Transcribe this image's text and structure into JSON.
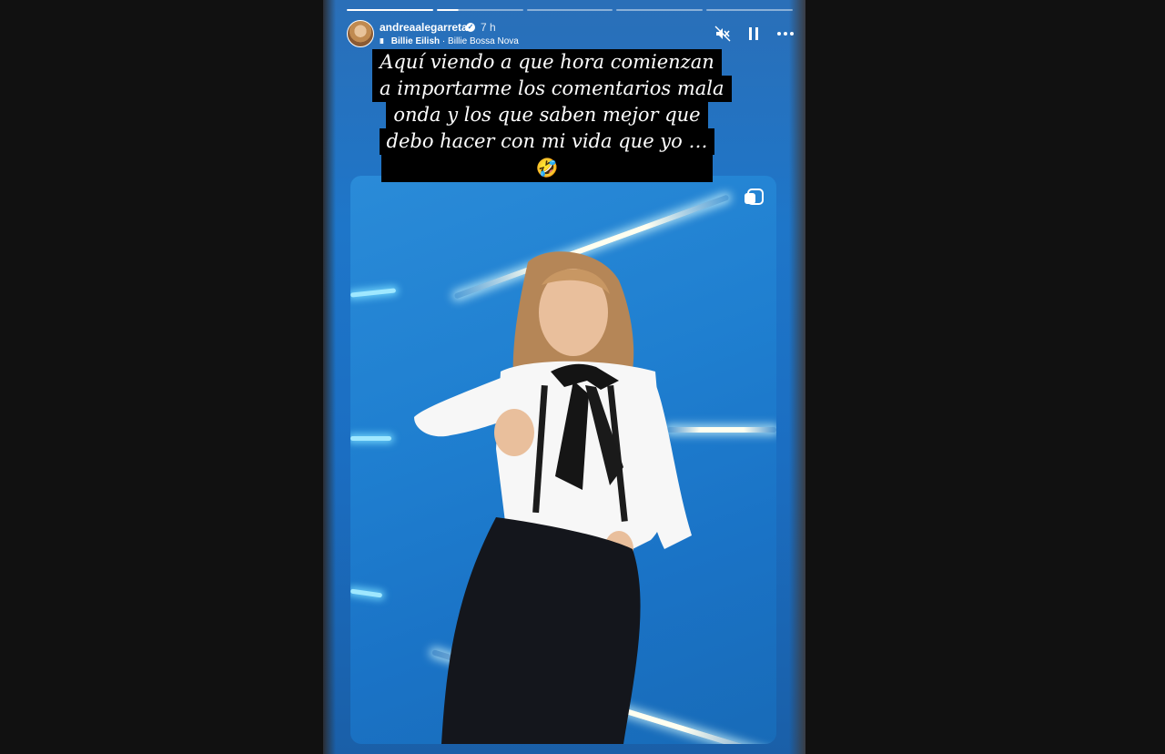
{
  "story": {
    "progress_segments": 5,
    "active_segment": 2,
    "username": "andreaalegarreta",
    "time": "7 h",
    "music": {
      "artist": "Billie Eilish",
      "separator": "·",
      "track": "Billie Bossa Nova"
    },
    "icons": {
      "mute": "speaker-muted-icon",
      "pause": "pause-icon",
      "more": "more-icon",
      "verified": "verified-icon"
    },
    "caption_lines": [
      "Aquí viendo a que hora comienzan",
      "a importarme los comentarios mala",
      "onda y los que saben mejor que",
      "debo hacer con mi vida que yo …"
    ],
    "caption_emoji": "🤣"
  },
  "colors": {
    "backdrop": "#111111",
    "story_blue": "#1e76c9"
  }
}
